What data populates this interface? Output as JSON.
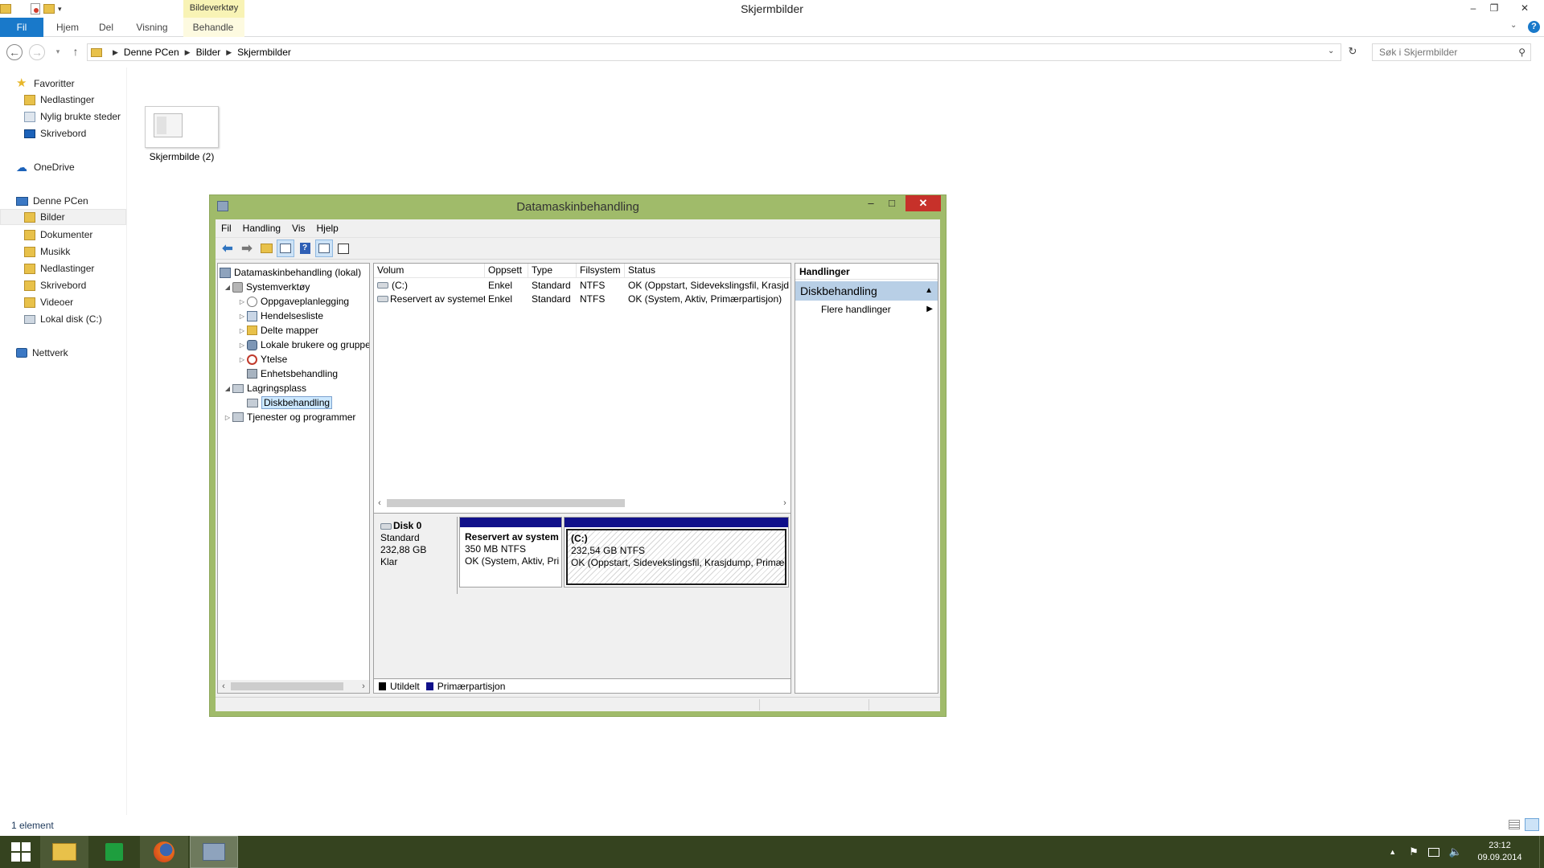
{
  "explorer": {
    "window_title": "Skjermbilder",
    "context_tab_group": "Bildeverktøy",
    "ribbon_tabs": [
      "Fil",
      "Hjem",
      "Del",
      "Visning",
      "Behandle"
    ],
    "breadcrumb": [
      "Denne PCen",
      "Bilder",
      "Skjermbilder"
    ],
    "search_placeholder": "Søk i Skjermbilder",
    "nav": {
      "favorites": "Favoritter",
      "downloads": "Nedlastinger",
      "recent": "Nylig brukte steder",
      "desktop": "Skrivebord",
      "onedrive": "OneDrive",
      "this_pc": "Denne PCen",
      "pictures": "Bilder",
      "documents": "Dokumenter",
      "music": "Musikk",
      "downloads2": "Nedlastinger",
      "desktop2": "Skrivebord",
      "videos": "Videoer",
      "local_disk": "Lokal disk (C:)",
      "network": "Nettverk"
    },
    "file_name": "Skjermbilde (2)",
    "status_count": "1 element"
  },
  "cm": {
    "title": "Datamaskinbehandling",
    "menu": [
      "Fil",
      "Handling",
      "Vis",
      "Hjelp"
    ],
    "tree": {
      "root": "Datamaskinbehandling (lokal)",
      "system_tools": "Systemverktøy",
      "task_scheduler": "Oppgaveplanlegging",
      "event_viewer": "Hendelsesliste",
      "shared_folders": "Delte mapper",
      "local_users": "Lokale brukere og grupper",
      "performance": "Ytelse",
      "device_manager": "Enhetsbehandling",
      "storage": "Lagringsplass",
      "disk_management": "Diskbehandling",
      "services": "Tjenester og programmer"
    },
    "columns": [
      "Volum",
      "Oppsett",
      "Type",
      "Filsystem",
      "Status"
    ],
    "volumes": [
      {
        "volume": "(C:)",
        "layout": "Enkel",
        "type": "Standard",
        "fs": "NTFS",
        "status": "OK (Oppstart, Sidevekslingsfil, Krasjdump, Primærpartisjon)"
      },
      {
        "volume": "Reservert av systemet",
        "layout": "Enkel",
        "type": "Standard",
        "fs": "NTFS",
        "status": "OK (System, Aktiv, Primærpartisjon)"
      }
    ],
    "disk": {
      "name": "Disk 0",
      "kind": "Standard",
      "size": "232,88 GB",
      "state": "Klar"
    },
    "partitions": [
      {
        "name": "Reservert av system",
        "size": "350 MB NTFS",
        "status": "OK (System, Aktiv, Primærpartisjon)"
      },
      {
        "name": "(C:)",
        "size": "232,54 GB NTFS",
        "status": "OK (Oppstart, Sidevekslingsfil, Krasjdump, Primærpartisjon)"
      }
    ],
    "legend": {
      "unallocated": "Utildelt",
      "primary": "Primærpartisjon",
      "unallocated_color": "#000000",
      "primary_color": "#10108a"
    },
    "actions": {
      "header": "Handlinger",
      "group": "Diskbehandling",
      "more": "Flere handlinger"
    }
  },
  "taskbar": {
    "time": "23:12",
    "date": "09.09.2014"
  },
  "colors": {
    "cm_frame": "#a0bb6a",
    "taskbar": "#35431f",
    "file_tab": "#1979ca",
    "close_button": "#c7312a"
  }
}
